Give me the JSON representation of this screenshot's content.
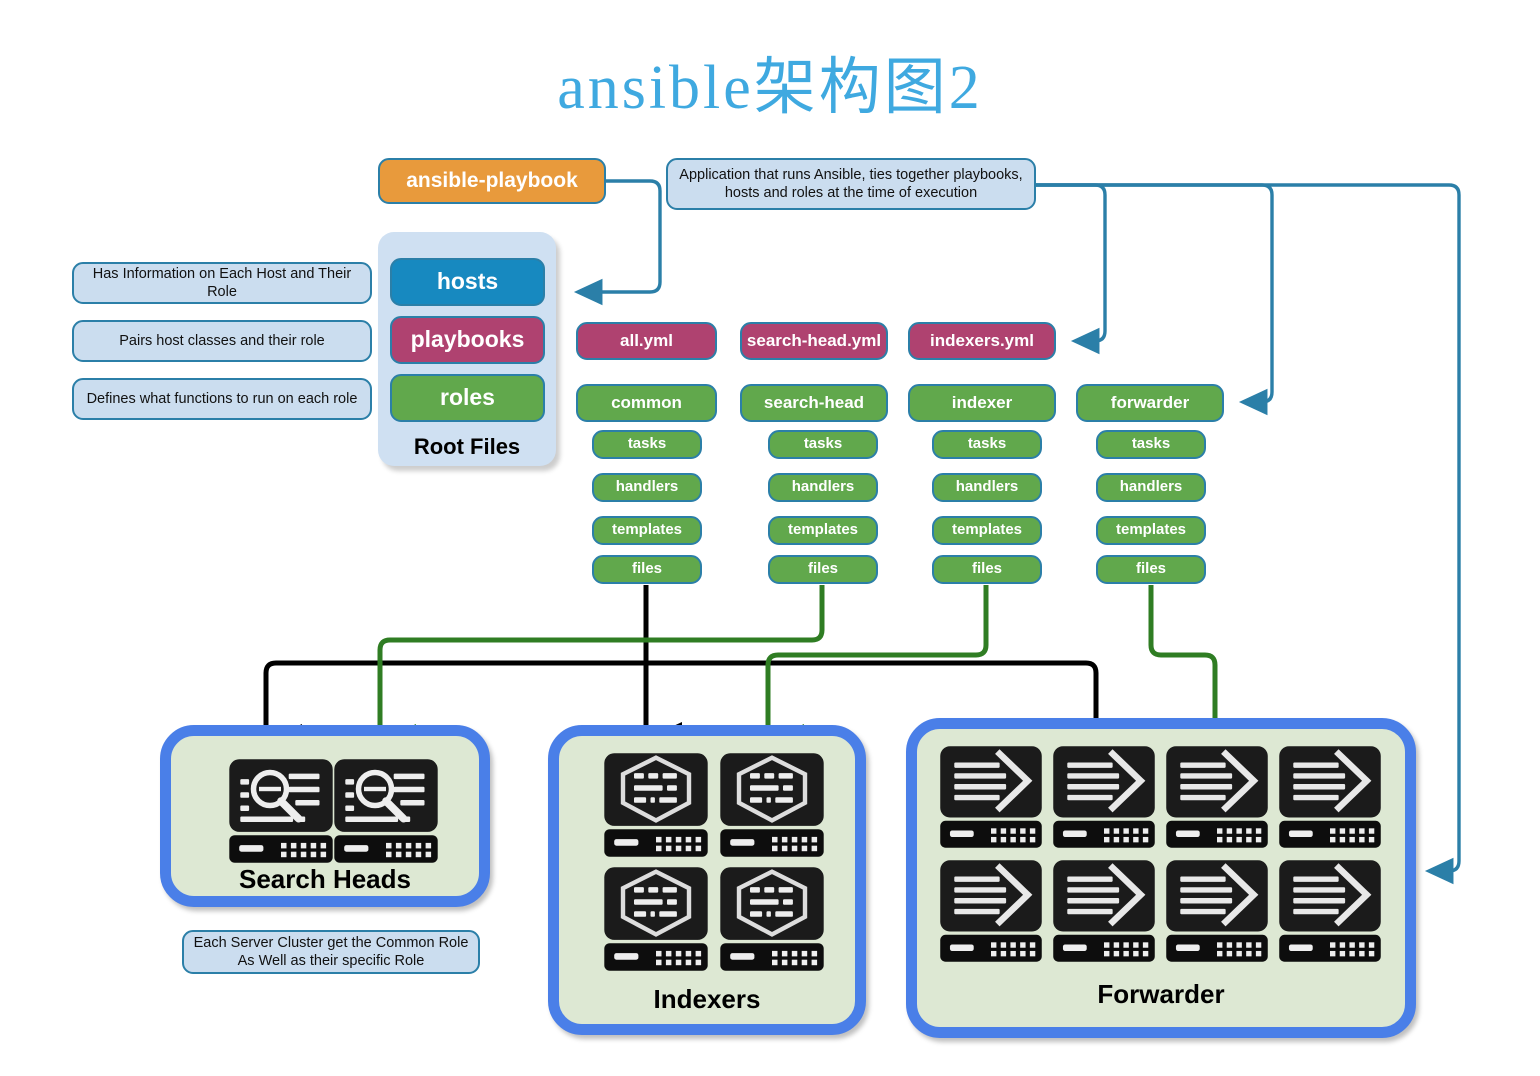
{
  "page": {
    "title": "ansible架构图2",
    "title_color": "#3FA9E0",
    "background": "#ffffff"
  },
  "palette": {
    "orange": "#E89A3C",
    "blue": "#1789C0",
    "magenta": "#AF4270",
    "green": "#61A84C",
    "info_fill": "#CBDDEF",
    "panel_fill": "#CFE0F2",
    "cluster_border": "#4A7FE8",
    "cluster_fill": "#DDE8D3",
    "stroke_blue": "#2B7FA8",
    "wire_black": "#000000",
    "wire_green": "#2F7D23",
    "wire_blue": "#2B7FA8"
  },
  "top": {
    "playbook_label": "ansible-playbook",
    "playbook_description": "Application that runs Ansible, ties together playbooks,\nhosts and roles at the time of execution"
  },
  "root_files": {
    "panel_label": "Root Files",
    "items": [
      {
        "label": "hosts",
        "color": "blue",
        "note": "Has Information on Each Host and Their Role"
      },
      {
        "label": "playbooks",
        "color": "magenta",
        "note": "Pairs host classes and their role"
      },
      {
        "label": "roles",
        "color": "green",
        "note": "Defines what functions to run on each role"
      }
    ]
  },
  "yml_files": [
    {
      "label": "all.yml"
    },
    {
      "label": "search-head.yml"
    },
    {
      "label": "indexers.yml"
    }
  ],
  "roles": [
    {
      "name": "common",
      "children": [
        "tasks",
        "handlers",
        "templates",
        "files"
      ]
    },
    {
      "name": "search-head",
      "children": [
        "tasks",
        "handlers",
        "templates",
        "files"
      ]
    },
    {
      "name": "indexer",
      "children": [
        "tasks",
        "handlers",
        "templates",
        "files"
      ]
    },
    {
      "name": "forwarder",
      "children": [
        "tasks",
        "handlers",
        "templates",
        "files"
      ]
    }
  ],
  "clusters": [
    {
      "id": "search-heads",
      "label": "Search Heads",
      "icon": "search-server-icon",
      "count": 2,
      "rows": 1,
      "cols": 2
    },
    {
      "id": "indexers",
      "label": "Indexers",
      "icon": "index-server-icon",
      "count": 4,
      "rows": 2,
      "cols": 2
    },
    {
      "id": "forwarder",
      "label": "Forwarder",
      "icon": "forward-server-icon",
      "count": 8,
      "rows": 2,
      "cols": 4
    }
  ],
  "footnote": {
    "text": "Each Server Cluster get the Common Role\nAs Well as their specific Role"
  }
}
